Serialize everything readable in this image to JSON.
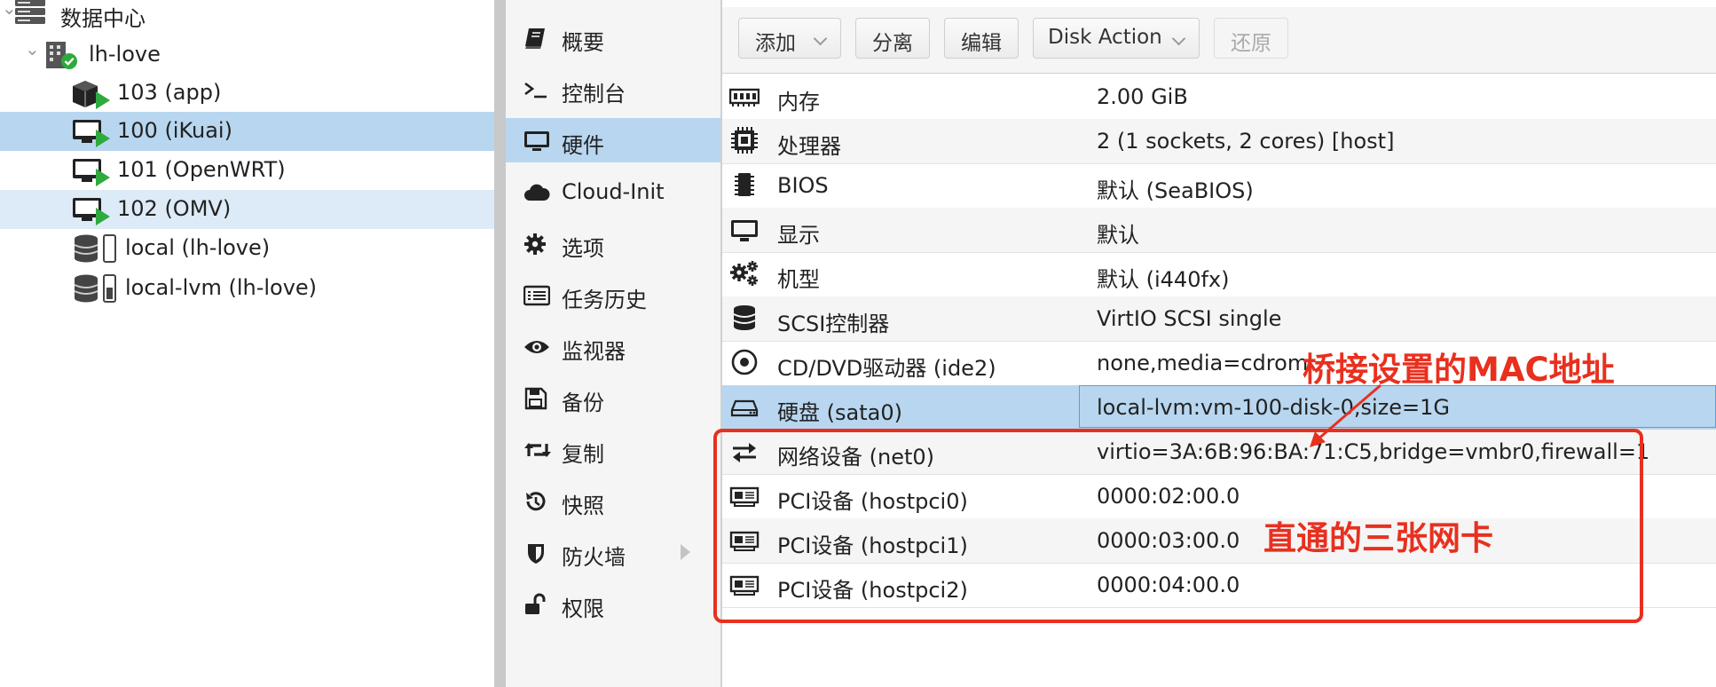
{
  "tree": {
    "datacenter": {
      "label": "数据中心"
    },
    "node": {
      "label": "lh-love"
    },
    "items": [
      {
        "label": "103 (app)",
        "type": "container"
      },
      {
        "label": "100 (iKuai)",
        "type": "vm",
        "selected": true
      },
      {
        "label": "101 (OpenWRT)",
        "type": "vm"
      },
      {
        "label": "102 (OMV)",
        "type": "vm",
        "hover": true
      },
      {
        "label": "local (lh-love)",
        "type": "storage"
      },
      {
        "label": "local-lvm (lh-love)",
        "type": "storage"
      }
    ]
  },
  "nav": {
    "items": [
      {
        "label": "概要",
        "icon": "book-icon"
      },
      {
        "label": "控制台",
        "icon": "terminal-icon"
      },
      {
        "label": "硬件",
        "icon": "monitor-icon",
        "selected": true
      },
      {
        "label": "Cloud-Init",
        "icon": "cloud-icon"
      },
      {
        "label": "选项",
        "icon": "gear-icon"
      },
      {
        "label": "任务历史",
        "icon": "list-icon"
      },
      {
        "label": "监视器",
        "icon": "eye-icon"
      },
      {
        "label": "备份",
        "icon": "floppy-icon"
      },
      {
        "label": "复制",
        "icon": "retweet-icon"
      },
      {
        "label": "快照",
        "icon": "history-icon"
      },
      {
        "label": "防火墙",
        "icon": "shield-icon"
      },
      {
        "label": "权限",
        "icon": "unlock-icon"
      }
    ]
  },
  "toolbar": {
    "add": "添加",
    "detach": "分离",
    "edit": "编辑",
    "disk_action": "Disk Action",
    "revert": "还原"
  },
  "hardware": [
    {
      "name": "内存",
      "value": "2.00 GiB",
      "icon": "memory-icon"
    },
    {
      "name": "处理器",
      "value": "2 (1 sockets, 2 cores) [host]",
      "icon": "cpu-icon"
    },
    {
      "name": "BIOS",
      "value": "默认 (SeaBIOS)",
      "icon": "chip-icon"
    },
    {
      "name": "显示",
      "value": "默认",
      "icon": "display-icon"
    },
    {
      "name": "机型",
      "value": "默认 (i440fx)",
      "icon": "cogs-icon"
    },
    {
      "name": "SCSI控制器",
      "value": "VirtIO SCSI single",
      "icon": "database-icon"
    },
    {
      "name": "CD/DVD驱动器 (ide2)",
      "value": "none,media=cdrom",
      "icon": "disc-icon"
    },
    {
      "name": "硬盘 (sata0)",
      "value": "local-lvm:vm-100-disk-0,size=1G",
      "icon": "hdd-icon",
      "selected": true
    },
    {
      "name": "网络设备 (net0)",
      "value": "virtio=3A:6B:96:BA:71:C5,bridge=vmbr0,firewall=1",
      "icon": "exchange-icon"
    },
    {
      "name": "PCI设备 (hostpci0)",
      "value": "0000:02:00.0",
      "icon": "pci-card-icon"
    },
    {
      "name": "PCI设备 (hostpci1)",
      "value": "0000:03:00.0",
      "icon": "pci-card-icon"
    },
    {
      "name": "PCI设备 (hostpci2)",
      "value": "0000:04:00.0",
      "icon": "pci-card-icon"
    }
  ],
  "annotations": {
    "mac_label": "桥接设置的MAC地址",
    "nic_label": "直通的三张网卡",
    "color": "#e8301f"
  }
}
